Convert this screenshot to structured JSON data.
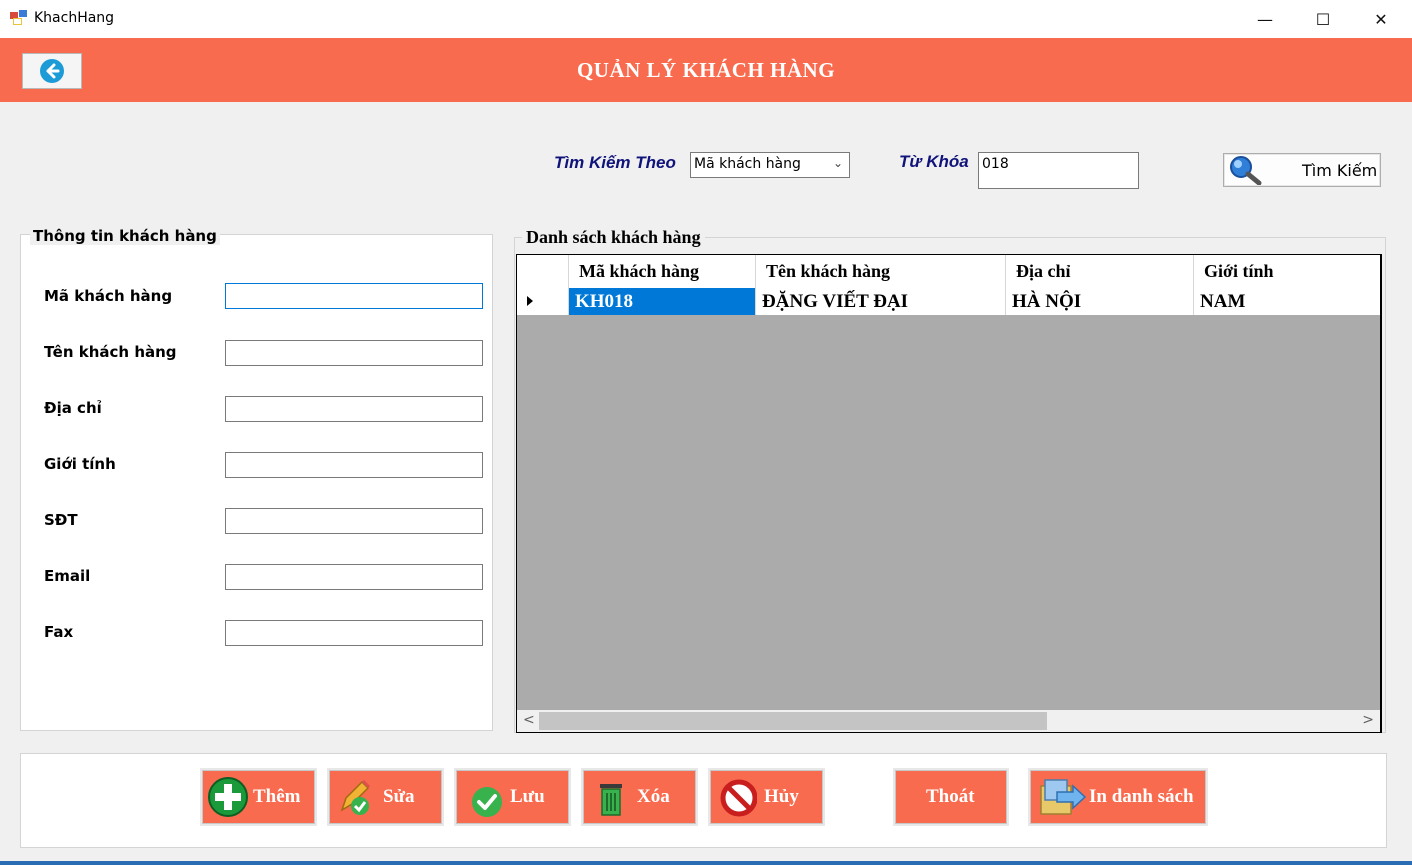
{
  "window": {
    "title": "KhachHang",
    "minimize": "—",
    "maximize": "☐",
    "close": "✕"
  },
  "header": {
    "title": "QUẢN LÝ KHÁCH HÀNG",
    "back_icon": "arrow-left-circle-icon",
    "color": "#f96b4e"
  },
  "search": {
    "by_label": "Tìm Kiếm Theo",
    "by_value": "Mã khách hàng",
    "keyword_label": "Từ Khóa",
    "keyword_value": "018",
    "button_label": "Tìm Kiếm"
  },
  "form": {
    "title": "Thông tin khách hàng",
    "fields": [
      {
        "label": "Mã khách hàng",
        "value": ""
      },
      {
        "label": "Tên khách hàng",
        "value": ""
      },
      {
        "label": "Địa chỉ",
        "value": ""
      },
      {
        "label": "Giới tính",
        "value": ""
      },
      {
        "label": "SĐT",
        "value": ""
      },
      {
        "label": "Email",
        "value": ""
      },
      {
        "label": "Fax",
        "value": ""
      }
    ]
  },
  "list": {
    "title": "Danh sách khách hàng",
    "columns": [
      "Mã khách hàng",
      "Tên khách hàng",
      "Địa chỉ",
      "Giới tính"
    ],
    "rows": [
      [
        "KH018",
        "ĐẶNG VIẾT ĐẠI",
        "HÀ NỘI",
        "NAM"
      ]
    ]
  },
  "actions": {
    "add": "Thêm",
    "edit": "Sửa",
    "save": "Lưu",
    "delete": "Xóa",
    "cancel": "Hủy",
    "exit": "Thoát",
    "print": "In danh sách"
  }
}
